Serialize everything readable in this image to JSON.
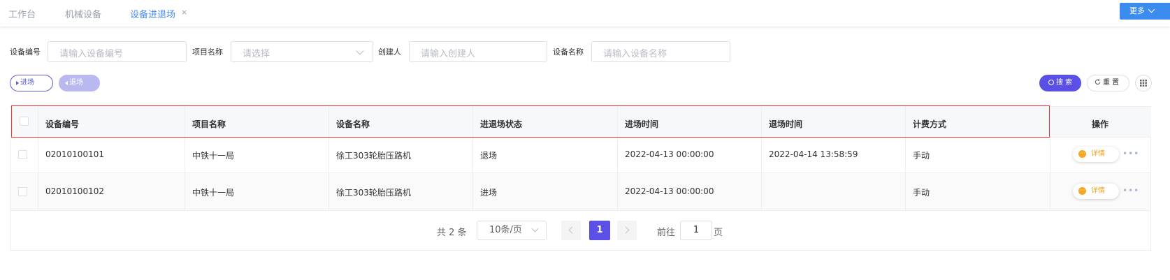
{
  "tabs": [
    {
      "label": "工作台",
      "active": false
    },
    {
      "label": "机械设备",
      "active": false
    },
    {
      "label": "设备进退场",
      "active": true
    }
  ],
  "tab_close": "×",
  "more_label": "更多",
  "filters": {
    "device_code_label": "设备编号",
    "device_code_placeholder": "请输入设备编号",
    "project_label": "项目名称",
    "project_placeholder": "请选择",
    "creator_label": "创建人",
    "creator_placeholder": "请输入创建人",
    "device_name_label": "设备名称",
    "device_name_placeholder": "请输入设备名称"
  },
  "actions": {
    "enter_label": "进场",
    "exit_label": "退场",
    "search_label": "搜 索",
    "reset_label": "重 置"
  },
  "table": {
    "columns": [
      "设备编号",
      "项目名称",
      "设备名称",
      "进退场状态",
      "进场时间",
      "退场时间",
      "计费方式",
      "操作"
    ],
    "rows": [
      {
        "code": "02010100101",
        "project": "中铁十一局",
        "name": "徐工303轮胎压路机",
        "status": "退场",
        "enter_time": "2022-04-13 00:00:00",
        "exit_time": "2022-04-14 13:58:59",
        "billing": "手动",
        "action": "详情"
      },
      {
        "code": "02010100102",
        "project": "中铁十一局",
        "name": "徐工303轮胎压路机",
        "status": "进场",
        "enter_time": "2022-04-13 00:00:00",
        "exit_time": "",
        "billing": "手动",
        "action": "详情"
      }
    ],
    "more_dots": "•••"
  },
  "pagination": {
    "total_text": "共 2 条",
    "page_size": "10条/页",
    "current_page": "1",
    "goto_label": "前往",
    "goto_value": "1",
    "page_unit": "页"
  },
  "colors": {
    "primary": "#5b50e6",
    "tab_active": "#4a8af4",
    "more_button": "#3c8cf0",
    "detail_orange": "#f0a020",
    "highlight_box": "#e53935"
  }
}
